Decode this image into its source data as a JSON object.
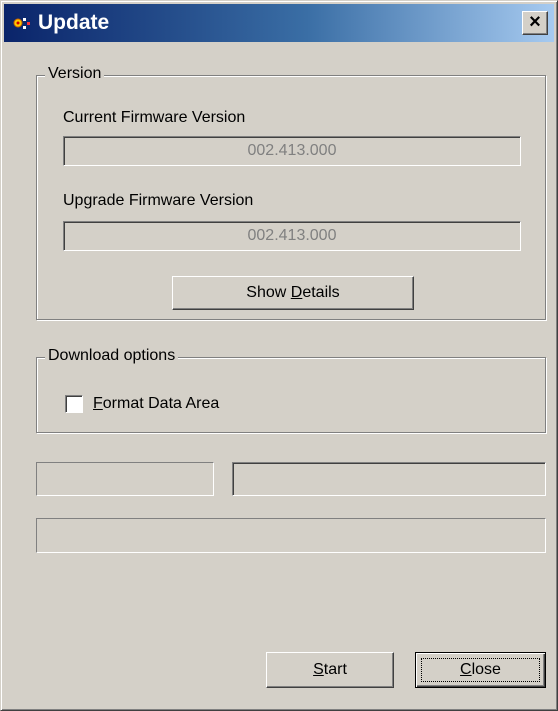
{
  "window": {
    "title": "Update",
    "close_label": "×",
    "app_icon": "app-icon"
  },
  "version_group": {
    "legend": "Version",
    "current_label": "Current Firmware Version",
    "current_value": "002.413.000",
    "upgrade_label": "Upgrade Firmware Version",
    "upgrade_value": "002.413.000",
    "details_button": {
      "pre": "Show ",
      "accel": "D",
      "post": "etails"
    }
  },
  "download_group": {
    "legend": "Download options",
    "format_checkbox": {
      "checked": false,
      "accel": "F",
      "post": "ormat Data Area"
    }
  },
  "status_fields": {
    "left": "",
    "right": "",
    "progress": ""
  },
  "buttons": {
    "start": {
      "accel": "S",
      "post": "tart"
    },
    "close": {
      "accel": "C",
      "post": "lose"
    }
  },
  "colors": {
    "face": "#d4d0c8",
    "title_start": "#0a246a",
    "title_end": "#a6caf0",
    "disabled_text": "#808080"
  }
}
